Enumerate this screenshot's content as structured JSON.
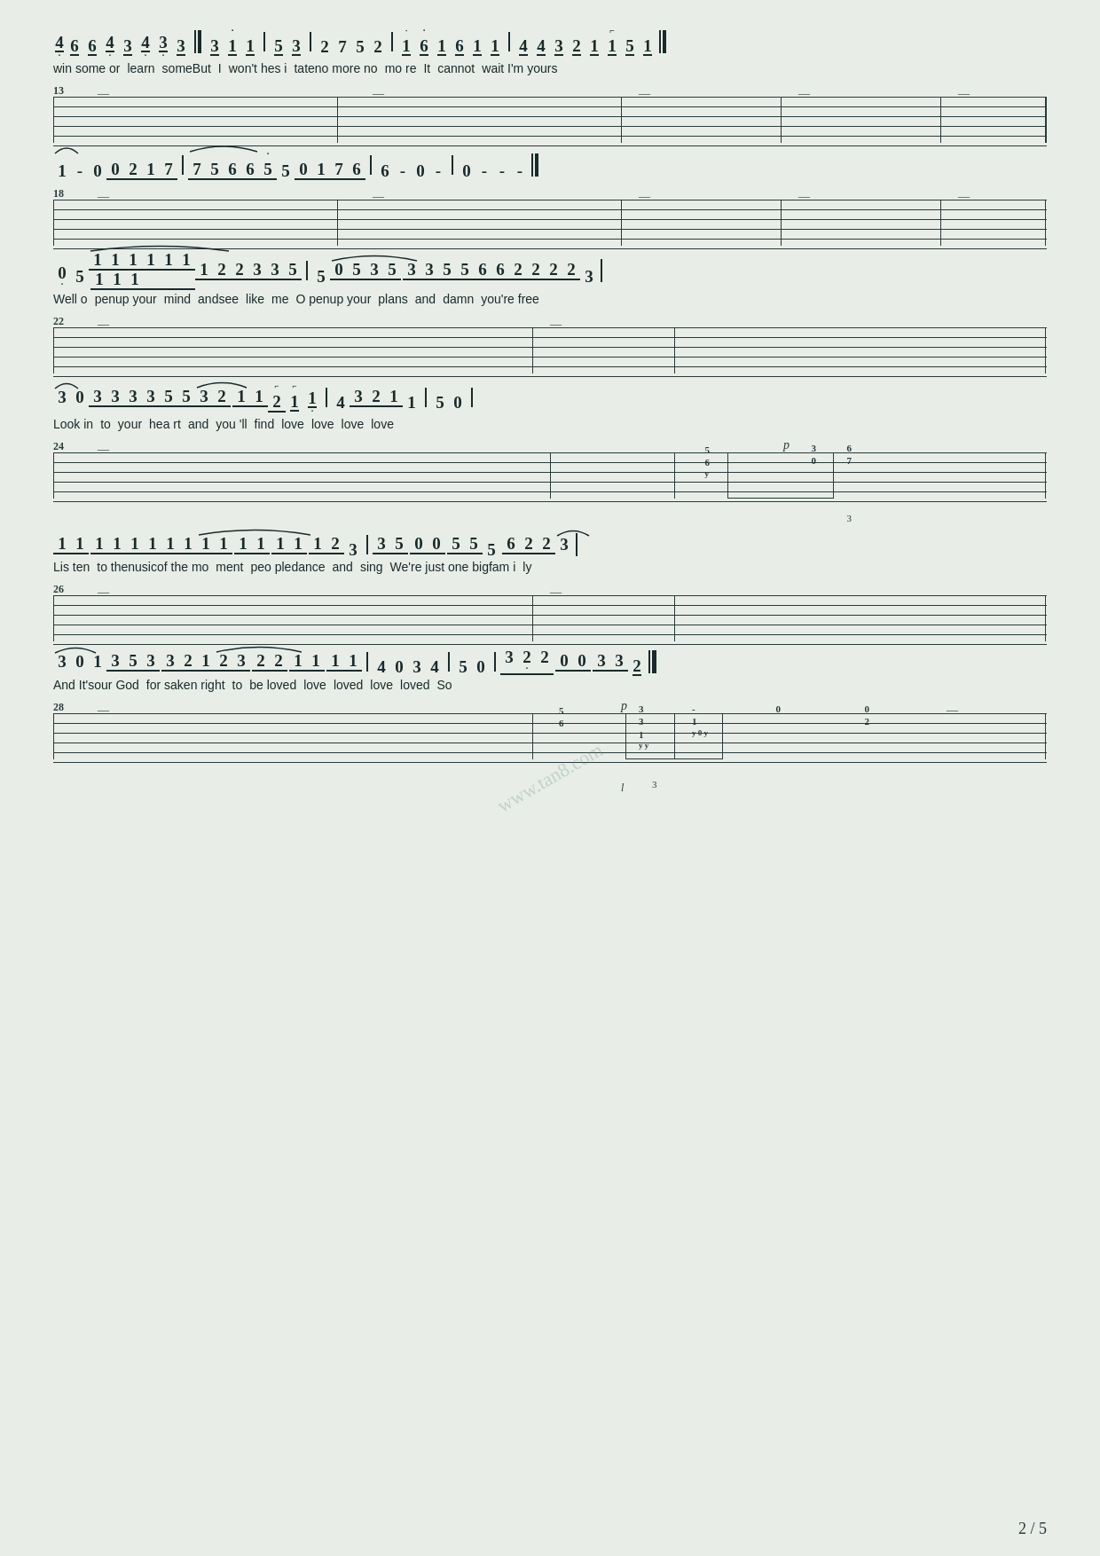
{
  "page": {
    "number": "2 / 5",
    "background": "#e8ede8"
  },
  "sections": [
    {
      "id": "s1",
      "type": "notation",
      "notes_text": "4· 6 6 4· 3 4· 3· 3 || 3 1· 1  5 3 | 2 7 5  2 | 1 6· 1  6 1 1 | 4  4  3 2 1 1 5 1",
      "lyrics": "win some or  learn  someBut    I    won't hes i   tateno more no   mo re  It  cannot  wait I'm yours"
    },
    {
      "id": "tab1",
      "type": "tab",
      "measure": "13"
    },
    {
      "id": "s2",
      "type": "notation",
      "notes_text": "1 - 0  0 2 1 7 | 7 5 6  6 5·  5  0 1 7 6 | 6 - 0 - | 0 - - -",
      "lyrics": ""
    },
    {
      "id": "tab2",
      "type": "tab",
      "measure": "18"
    },
    {
      "id": "s3",
      "type": "notation",
      "notes_text": "0· 5  1 1 1 1 1 1  1 1 1  1 2 2 3 3 5 | 5  0 5 3 5 3 3 5 5  6 6 2 2 2 2  3",
      "lyrics": "Well o  penup your  mind   andsee  like  me      O penup your  plans  and  damn  you're free"
    },
    {
      "id": "tab3",
      "type": "tab",
      "measure": "22"
    },
    {
      "id": "s4",
      "type": "notation",
      "notes_text": "3  0  3 3 3 3 5 5 3 2  1 1 2  1 1·  | 4   3 2 1   1    5 0 |",
      "lyrics": "Look in  to  your   hea rt   and  you 'll  find    love    love    love    love"
    },
    {
      "id": "tab4",
      "type": "tab",
      "measure": "24",
      "has_chord": true
    },
    {
      "id": "s5",
      "type": "notation",
      "notes_text": "1 1  1 1 1 1 1 1  1 1 1 1 1 1 1 2  3 | 3 5  0 0 5  5  5  6 2 2 3",
      "lyrics": "Lis ten  to thenusicof the mo  ment  peo pledance   and   sing   We're just one bigfam i  ly"
    },
    {
      "id": "tab5",
      "type": "tab",
      "measure": "26"
    },
    {
      "id": "s6",
      "type": "notation",
      "notes_text": "3  0 1  3 5 3  3 2 1 2 3 2 2 1 1 1 1  | 4   0  3  4   5 0 | 3 2· 2  0 0 3 3 2 ||",
      "lyrics": "And It'sour God   for saken right  to  be loved  love    loved    love  loved    So"
    },
    {
      "id": "tab6",
      "type": "tab",
      "measure": "28",
      "has_chord": true
    }
  ],
  "watermark": "www.tan8.com"
}
